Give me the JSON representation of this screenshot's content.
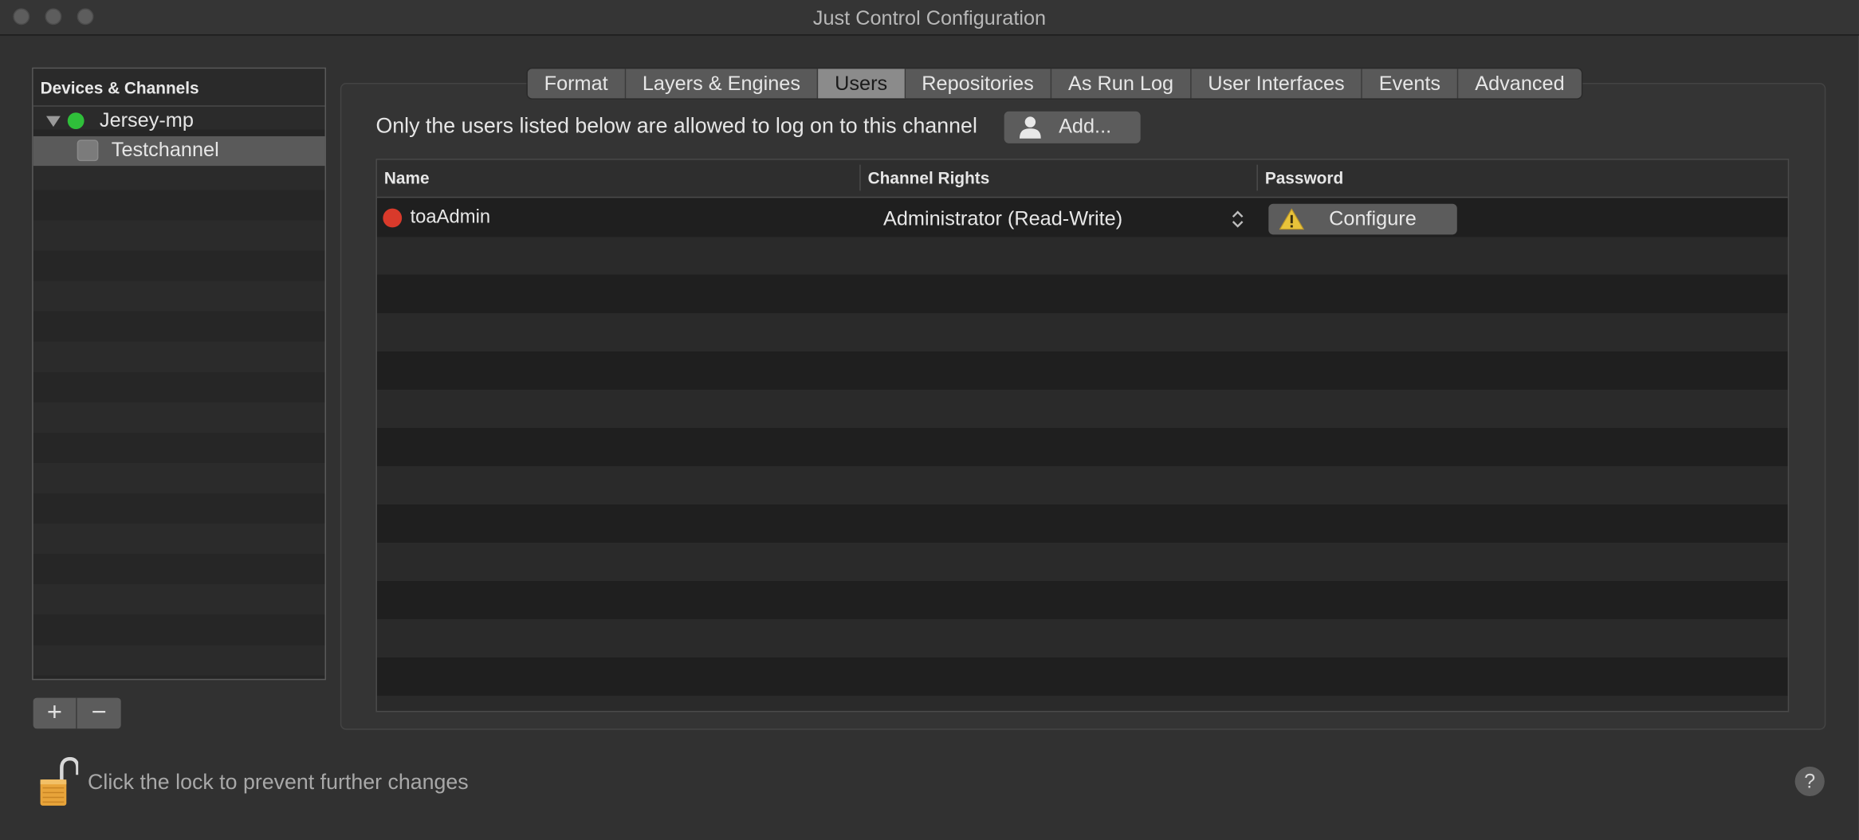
{
  "window": {
    "title": "Just Control Configuration"
  },
  "sidebar": {
    "header": "Devices & Channels",
    "items": [
      {
        "label": "Jersey-mp",
        "status": "online"
      },
      {
        "label": "Testchannel",
        "selected": true
      }
    ],
    "add_label": "+",
    "remove_label": "−"
  },
  "tabs": [
    "Format",
    "Layers & Engines",
    "Users",
    "Repositories",
    "As Run Log",
    "User Interfaces",
    "Events",
    "Advanced"
  ],
  "active_tab": "Users",
  "users": {
    "info_text": "Only the users listed below are allowed to log on to this channel",
    "add_button_label": "Add...",
    "columns": [
      "Name",
      "Channel Rights",
      "Password"
    ],
    "rows": [
      {
        "name": "toaAdmin",
        "rights": "Administrator (Read-Write)",
        "password_action": "Configure"
      }
    ]
  },
  "footer": {
    "lock_text": "Click the lock to prevent further changes",
    "help_label": "?"
  },
  "colors": {
    "status_green": "#2fbf3a",
    "status_red": "#d93a2b",
    "warning_yellow": "#e8c33a",
    "lock_orange": "#e8a43a"
  }
}
